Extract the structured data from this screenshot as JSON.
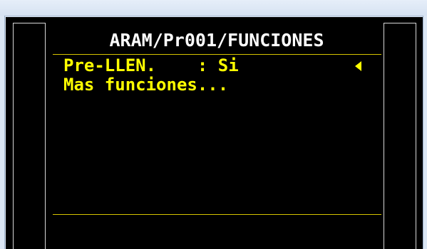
{
  "lcd": {
    "title": "ARAM/Pr001/FUNCIONES",
    "menu_items": [
      {
        "label": "Pre-LLEN.    : Si"
      },
      {
        "label": "Mas funciones..."
      }
    ],
    "cursor_icon": "left-triangle-icon"
  },
  "colors": {
    "screen_background": "#000000",
    "title_text": "#ffffff",
    "menu_text": "#ffff00",
    "separator": "#d6c400",
    "window_frame": "#dbe6f4"
  }
}
